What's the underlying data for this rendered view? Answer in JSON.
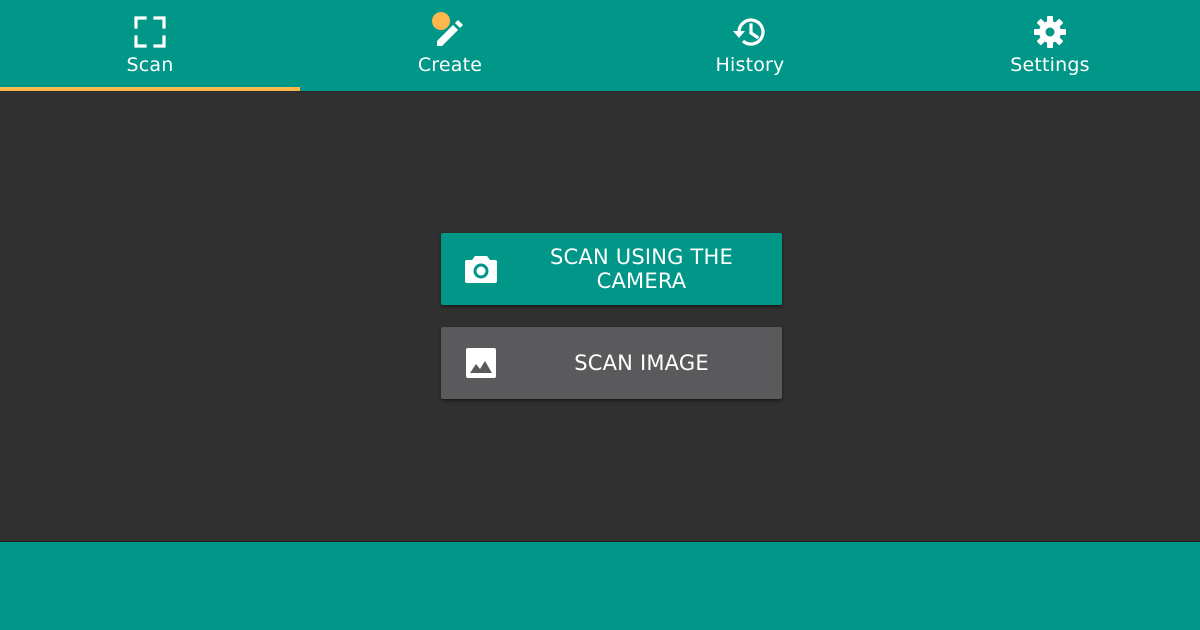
{
  "tabs": [
    {
      "label": "Scan",
      "icon": "scan-frame-icon",
      "active": true
    },
    {
      "label": "Create",
      "icon": "pencil-icon",
      "active": false
    },
    {
      "label": "History",
      "icon": "history-icon",
      "active": false
    },
    {
      "label": "Settings",
      "icon": "gear-icon",
      "active": false
    }
  ],
  "actions": {
    "scan_camera_label": "SCAN USING THE CAMERA",
    "scan_image_label": "SCAN IMAGE"
  },
  "colors": {
    "primary": "#009688",
    "accent": "#ffb74d",
    "background": "#303030",
    "secondary_button": "#5a5a5c"
  }
}
